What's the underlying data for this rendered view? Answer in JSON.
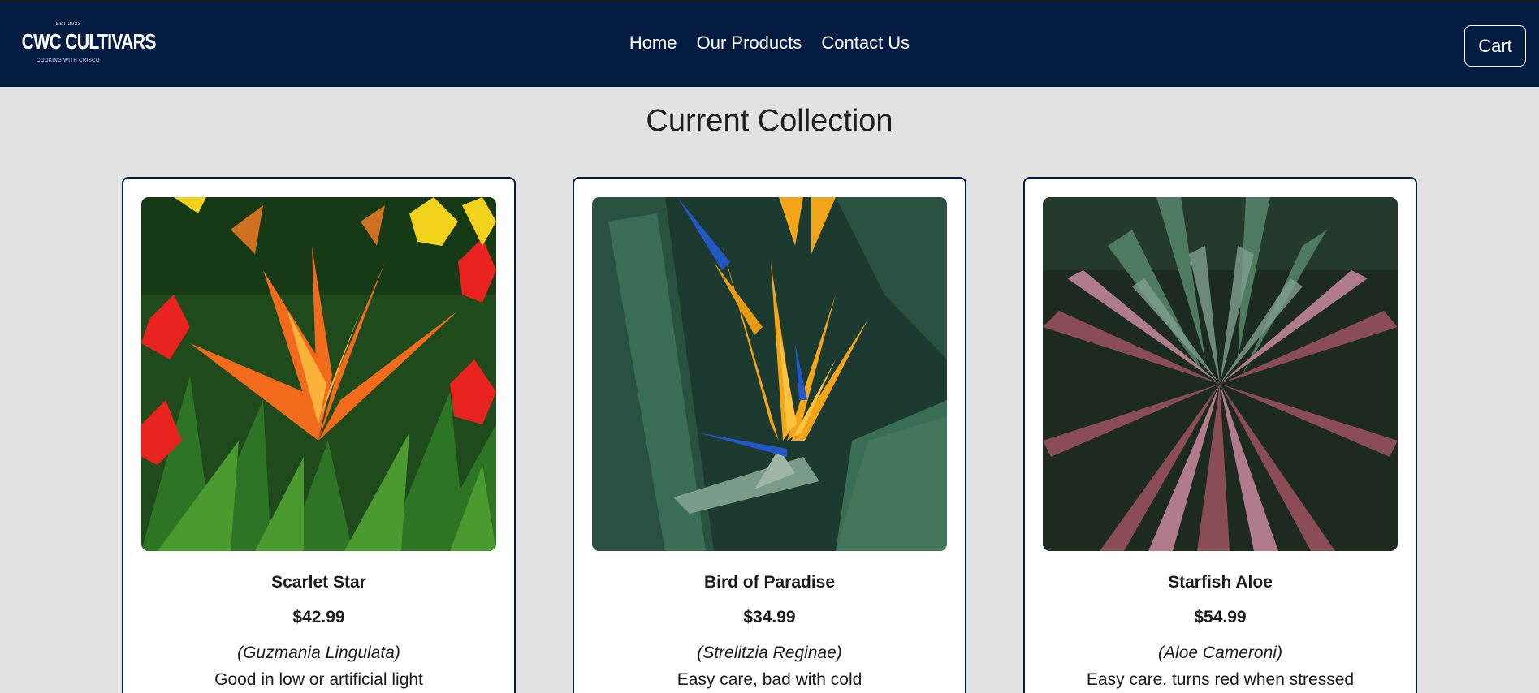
{
  "navbar": {
    "logo": {
      "est": "EST 2023",
      "brand": "CWC CULTIVARS",
      "tagline": "COOKING WITH CRISCO"
    },
    "links": [
      "Home",
      "Our Products",
      "Contact Us"
    ],
    "cart_label": "Cart",
    "background": "#041c42"
  },
  "main": {
    "title": "Current Collection"
  },
  "products": [
    {
      "name": "Scarlet Star",
      "price": "$42.99",
      "scientific": "(Guzmania Lingulata)",
      "description": "Good in low or artificial light",
      "image": "bromeliad-photo"
    },
    {
      "name": "Bird of Paradise",
      "price": "$34.99",
      "scientific": "(Strelitzia Reginae)",
      "description": "Easy care, bad with cold",
      "image": "bird-of-paradise-photo"
    },
    {
      "name": "Starfish Aloe",
      "price": "$54.99",
      "scientific": "(Aloe Cameroni)",
      "description": "Easy care, turns red when stressed",
      "image": "aloe-photo"
    }
  ]
}
